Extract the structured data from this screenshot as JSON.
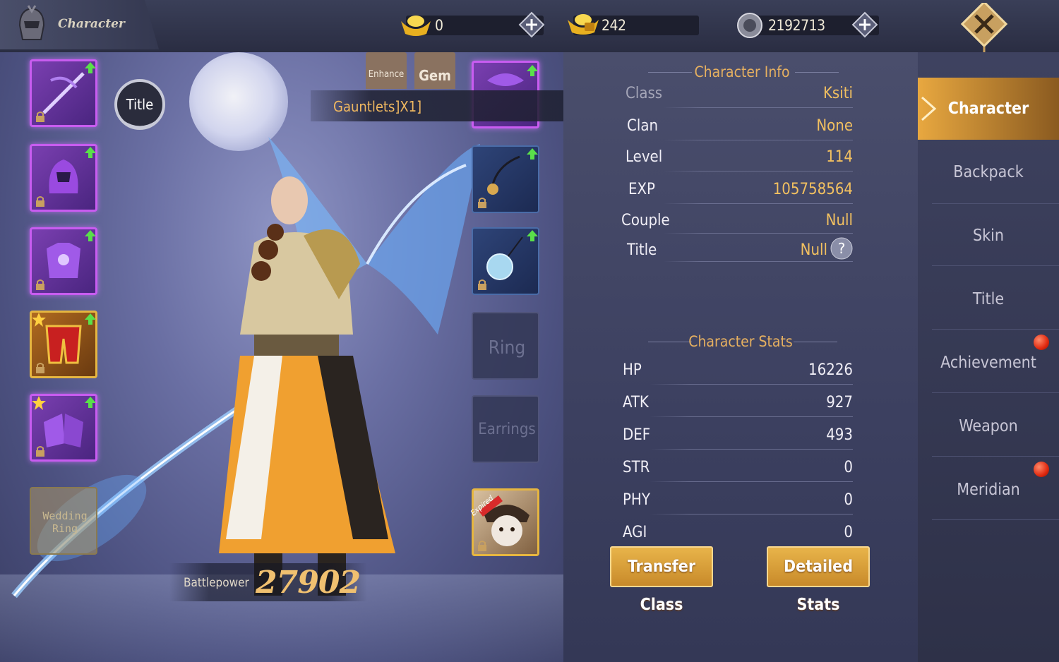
{
  "header": {
    "title": "Character",
    "currencies": [
      {
        "name": "gold-ingot-icon",
        "value": "0"
      },
      {
        "name": "bound-gold-icon",
        "value": "242"
      },
      {
        "name": "silver-coin-icon",
        "value": "2192713"
      }
    ]
  },
  "equipment_tabs": {
    "enhance": "Enhance",
    "gem": "Gem"
  },
  "title_badge": "Title",
  "tooltip": "Gauntlets]X1]",
  "slots": {
    "ring": "Ring",
    "earrings": "Earrings",
    "wedding_ring": "Wedding Ring",
    "expired": "Expired"
  },
  "character_info": {
    "heading": "Character Info",
    "rows": [
      {
        "label": "Class",
        "value": "Ksiti"
      },
      {
        "label": "Clan",
        "value": "None"
      },
      {
        "label": "Level",
        "value": "114"
      },
      {
        "label": "EXP",
        "value": "105758564"
      },
      {
        "label": "Couple",
        "value": "Null"
      },
      {
        "label": "Title",
        "value": "Null"
      }
    ]
  },
  "character_stats": {
    "heading": "Character Stats",
    "rows": [
      {
        "label": "HP",
        "value": "16226"
      },
      {
        "label": "ATK",
        "value": "927"
      },
      {
        "label": "DEF",
        "value": "493"
      },
      {
        "label": "STR",
        "value": "0"
      },
      {
        "label": "PHY",
        "value": "0"
      },
      {
        "label": "AGI",
        "value": "0"
      }
    ]
  },
  "buttons": {
    "transfer_class": "Transfer Class",
    "detailed_stats": "Detailed Stats"
  },
  "battlepower": {
    "label": "Battlepower",
    "value": "27902"
  },
  "nav": [
    "Character",
    "Backpack",
    "Skin",
    "Title",
    "Achievement",
    "Weapon",
    "Meridian"
  ],
  "colors": {
    "accent_gold": "#f2c060",
    "active_tab": "#e8a840",
    "slot_purple": "#c85cf0"
  }
}
